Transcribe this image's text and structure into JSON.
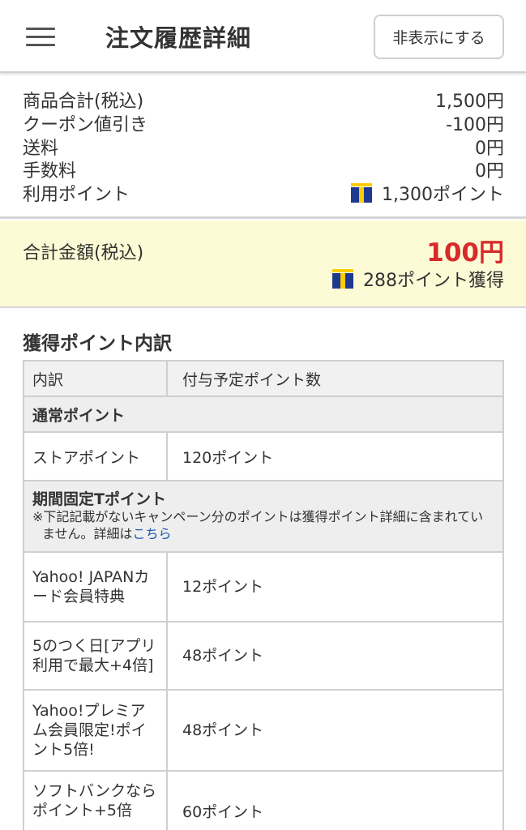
{
  "header": {
    "title": "注文履歴詳細",
    "hide_button": "非表示にする",
    "menu_icon": "hamburger-menu-icon"
  },
  "summary": {
    "rows": [
      {
        "label": "商品合計(税込)",
        "value": "1,500円"
      },
      {
        "label": "クーポン値引き",
        "value": "-100円"
      },
      {
        "label": "送料",
        "value": "0円"
      },
      {
        "label": "手数料",
        "value": "0円"
      },
      {
        "label": "利用ポイント",
        "value": "1,300ポイント"
      }
    ],
    "point_icon": "t-point-icon"
  },
  "total": {
    "label": "合計金額(税込)",
    "amount": "100円",
    "earned": "288ポイント獲得"
  },
  "points": {
    "title": "獲得ポイント内訳",
    "columns": [
      "内訳",
      "付与予定ポイント数"
    ],
    "group1": "通常ポイント",
    "store_row": {
      "label": "ストアポイント",
      "value": "120ポイント"
    },
    "group2": {
      "title": "期間固定Tポイント",
      "note": "※下記記載がないキャンペーン分のポイントは獲得ポイント詳細に含まれていません。詳細は",
      "link": "こちら"
    },
    "rows": [
      {
        "label": "Yahoo! JAPANカード会員特典",
        "value": "12ポイント"
      },
      {
        "label": "5のつく日[アプリ利用で最大+4倍]",
        "value": "48ポイント"
      },
      {
        "label": "Yahoo!プレミアム会員限定!ポイント5倍!",
        "value": "48ポイント"
      },
      {
        "label": "ソフトバンクなら ポイント+5倍",
        "value": "60ポイント"
      }
    ]
  },
  "colors": {
    "total_amount": "#d72a2a",
    "total_bg": "#fdfbd5",
    "link": "#1a59b3"
  }
}
